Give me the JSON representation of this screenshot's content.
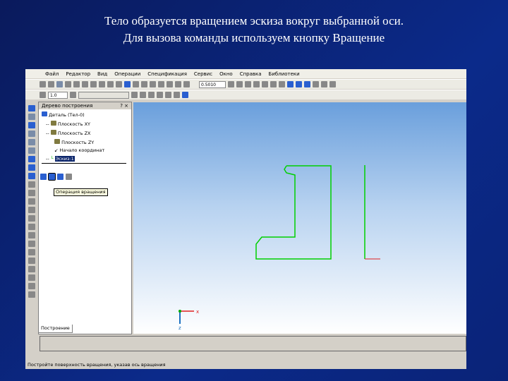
{
  "slide": {
    "title_line1": "Тело образуется вращением эскиза вокруг выбранной оси.",
    "title_line2": "Для вызова команды используем кнопку Вращение"
  },
  "menu": [
    "Файл",
    "Редактор",
    "Вид",
    "Операции",
    "Спецификация",
    "Сервис",
    "Окно",
    "Справка",
    "Библиотеки"
  ],
  "toolbar": {
    "zoom_value": "0.5010",
    "step_value": "1.0"
  },
  "tree": {
    "title": "Дерево построения",
    "controls": "? ×",
    "root": "Деталь (Тел-0)",
    "items": [
      "Плоскость XY",
      "Плоскость ZX",
      "Плоскость ZY",
      "Начало координат",
      "Эскиз:1"
    ],
    "tab": "Построение"
  },
  "tooltip": "Операция вращения",
  "axes": {
    "x": "x",
    "z": "z"
  },
  "status": "Постройте поверхность вращения, указав ось вращения",
  "colors": {
    "sketch": "#00d000",
    "axis_x": "#e02020",
    "axis_z": "#1a70c0"
  }
}
